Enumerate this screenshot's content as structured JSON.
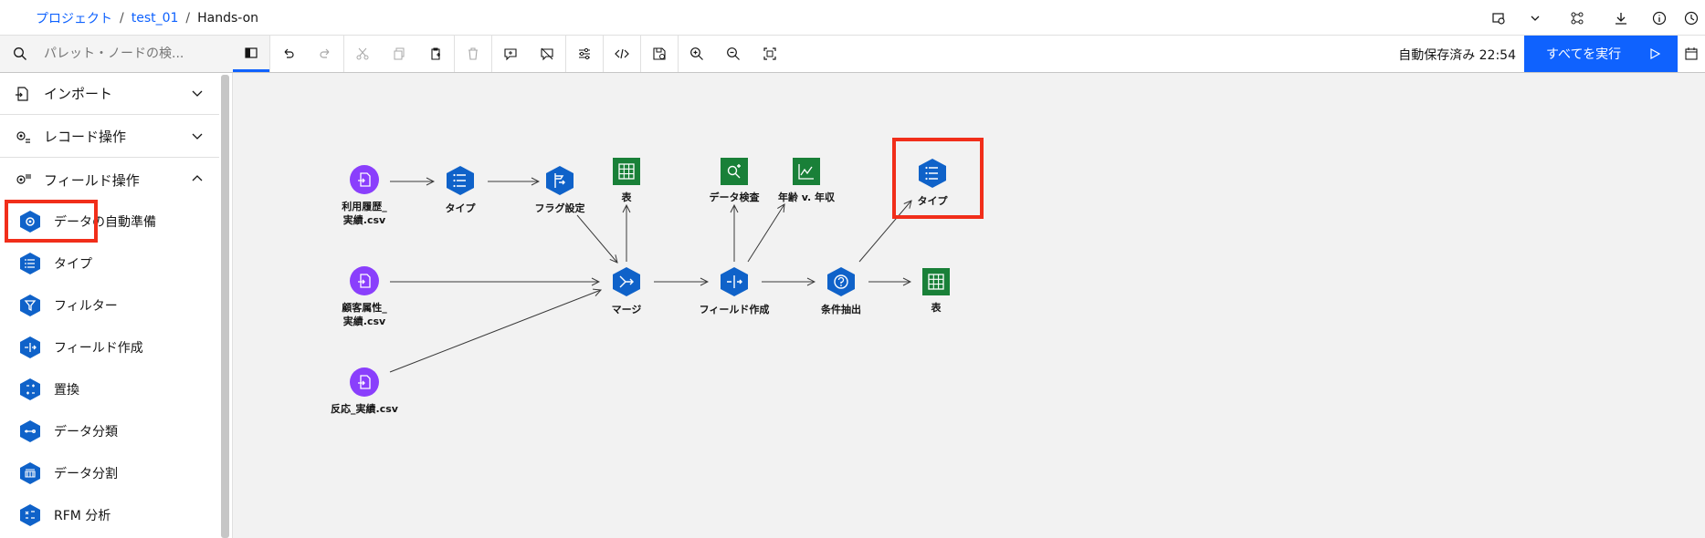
{
  "breadcrumb": {
    "project": "プロジェクト",
    "sep1": "/",
    "test": "test_01",
    "sep2": "/",
    "current": "Hands-on"
  },
  "toolbar": {
    "search_placeholder": "パレット・ノードの検...",
    "autosave": "自動保存済み 22:54",
    "run_all": "すべてを実行"
  },
  "sidebar": {
    "categories": [
      {
        "label": "インポート",
        "expanded": false
      },
      {
        "label": "レコード操作",
        "expanded": false
      },
      {
        "label": "フィールド操作",
        "expanded": true
      }
    ],
    "items": [
      {
        "label": "データの自動準備",
        "icon": "gear-hex-icon"
      },
      {
        "label": "タイプ",
        "icon": "list-hex-icon"
      },
      {
        "label": "フィルター",
        "icon": "filter-hex-icon"
      },
      {
        "label": "フィールド作成",
        "icon": "derive-hex-icon"
      },
      {
        "label": "置換",
        "icon": "replace-hex-icon"
      },
      {
        "label": "データ分類",
        "icon": "bin-hex-icon"
      },
      {
        "label": "データ分割",
        "icon": "partition-hex-icon"
      },
      {
        "label": "RFM 分析",
        "icon": "rfm-hex-icon"
      }
    ]
  },
  "canvas": {
    "nodes": {
      "usage_csv": "利用履歴_実績.csv",
      "type1": "タイプ",
      "flag": "フラグ設定",
      "table1": "表",
      "audit": "データ検査",
      "plot": "年齢 v. 年収",
      "type2": "タイプ",
      "customer_csv": "顧客属性_実績.csv",
      "merge": "マージ",
      "derive": "フィールド作成",
      "select": "条件抽出",
      "table2": "表",
      "response_csv": "反応_実績.csv"
    }
  },
  "colors": {
    "accent": "#0f62fe",
    "source_node": "#8a3ffc",
    "process_node": "#0f62c9",
    "output_node": "#198038",
    "highlight": "#f12e1a"
  }
}
